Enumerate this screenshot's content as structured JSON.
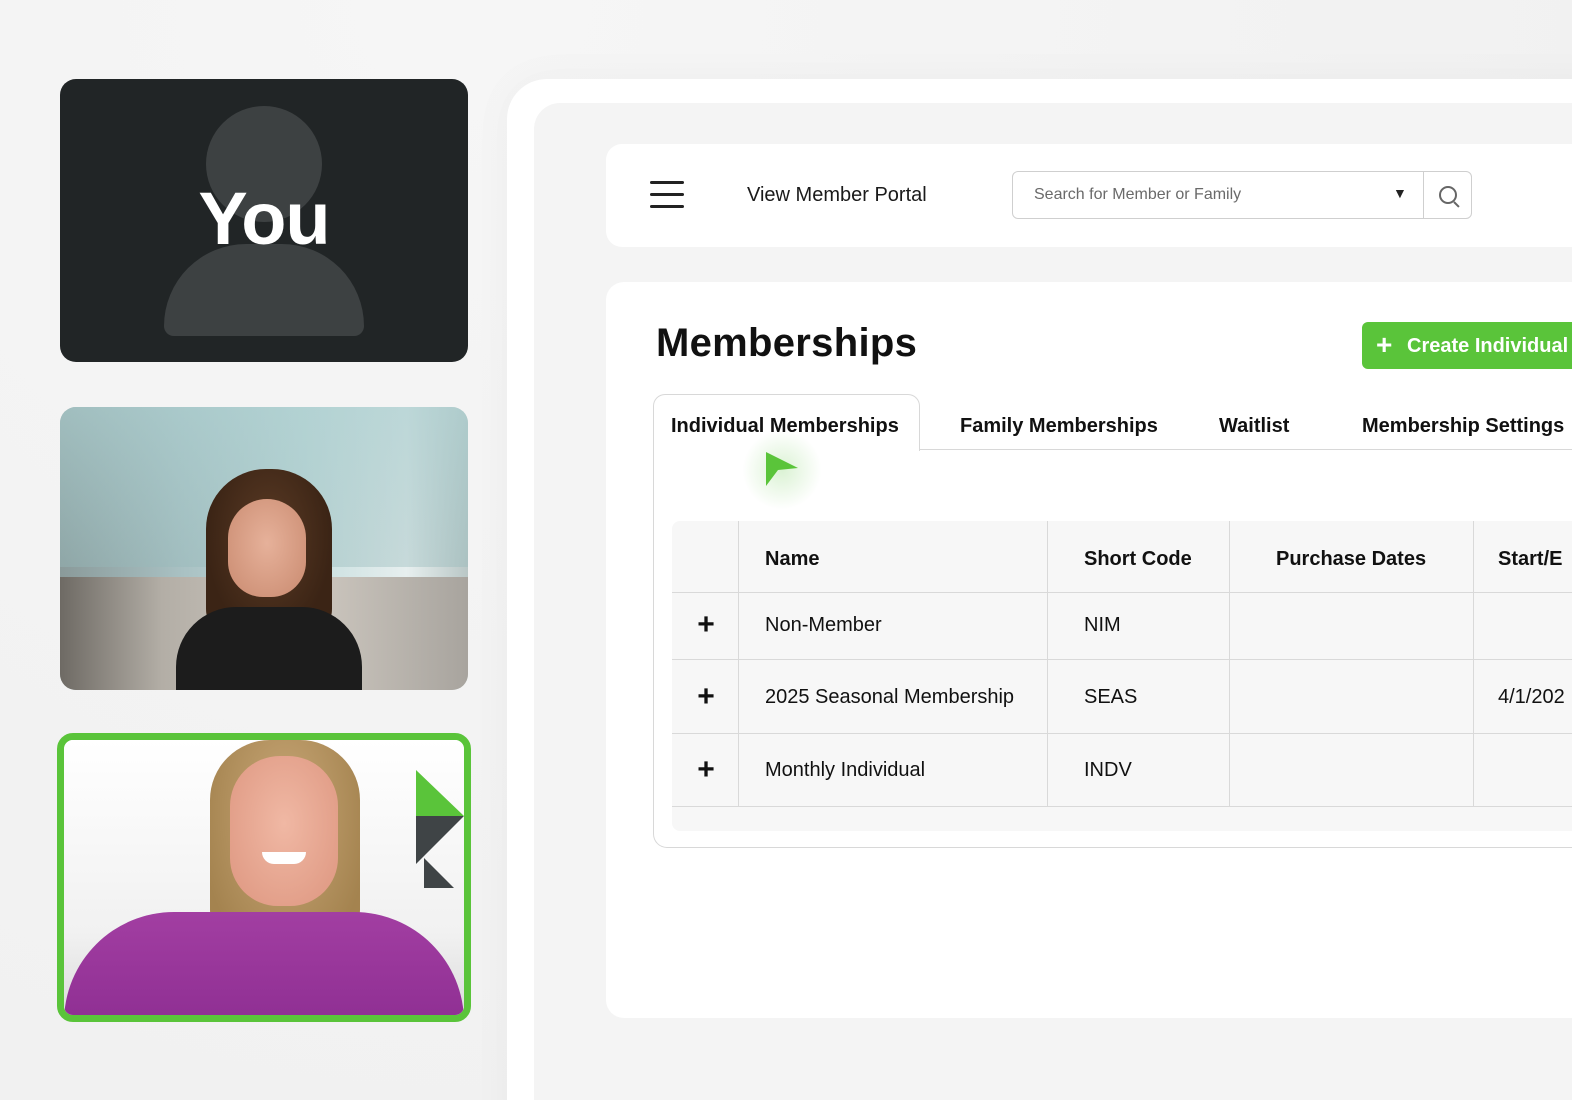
{
  "participants": {
    "self_label": "You"
  },
  "header": {
    "portal_link": "View Member Portal",
    "search": {
      "placeholder": "Search for Member or Family",
      "caret": "▼"
    }
  },
  "page": {
    "title": "Memberships",
    "create_button": "Create Individual",
    "create_plus": "+"
  },
  "tabs": [
    {
      "label": "Individual Memberships",
      "active": true
    },
    {
      "label": "Family Memberships",
      "active": false
    },
    {
      "label": "Waitlist",
      "active": false
    },
    {
      "label": "Membership Settings",
      "active": false
    }
  ],
  "table": {
    "headers": [
      "Name",
      "Short Code",
      "Purchase Dates",
      "Start/E"
    ],
    "expand_symbol": "+",
    "rows": [
      {
        "name": "Non-Member",
        "short_code": "NIM",
        "purchase_dates": "",
        "start_end": ""
      },
      {
        "name": "2025 Seasonal Membership",
        "short_code": "SEAS",
        "purchase_dates": "",
        "start_end": "4/1/202"
      },
      {
        "name": "Monthly Individual",
        "short_code": "INDV",
        "purchase_dates": "",
        "start_end": ""
      }
    ]
  },
  "colors": {
    "accent": "#5ac43a",
    "dark_tile": "#212526"
  }
}
